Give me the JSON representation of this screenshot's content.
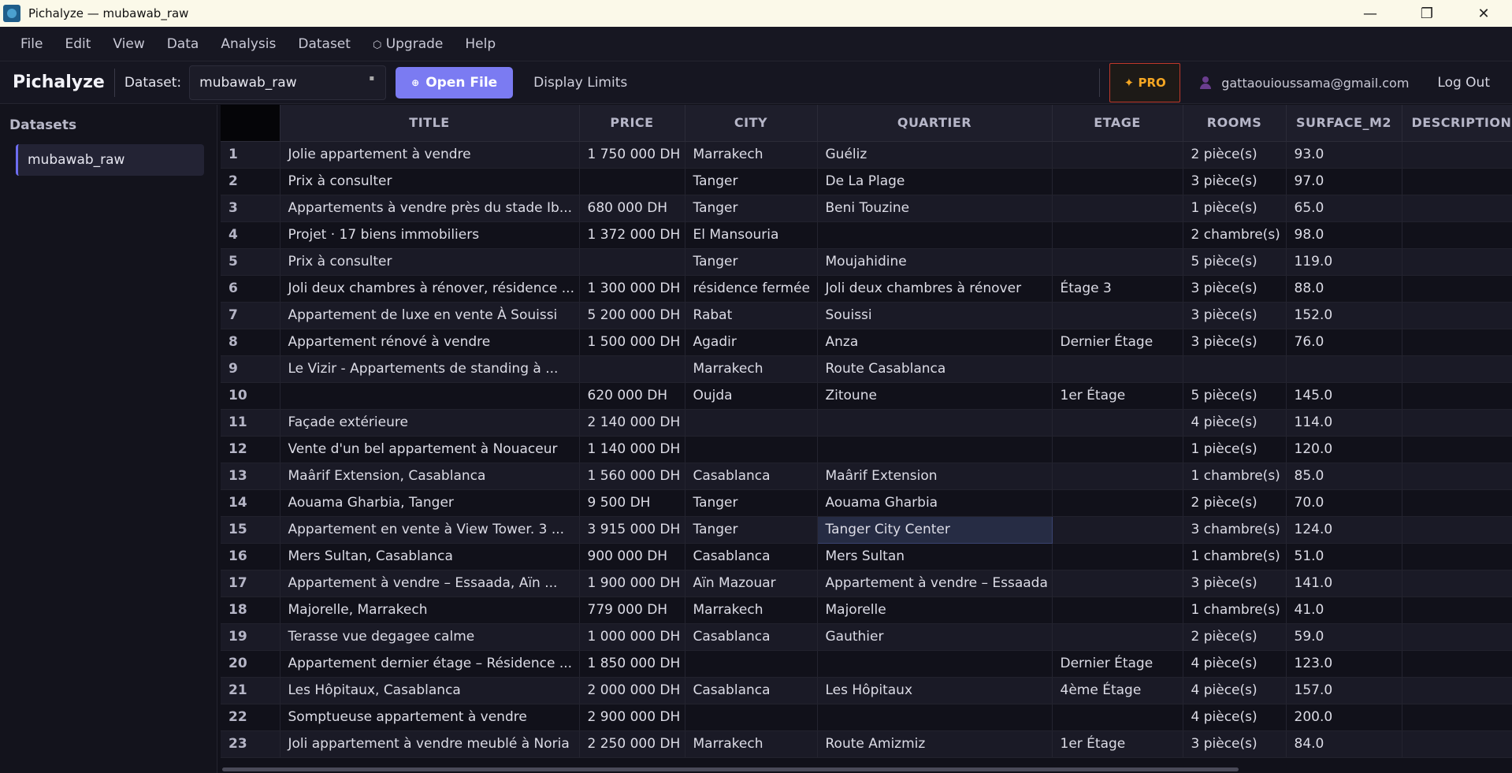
{
  "window": {
    "title": "Pichalyze — mubawab_raw",
    "controls": [
      "—",
      "❐",
      "✕"
    ]
  },
  "menu": [
    "File",
    "Edit",
    "View",
    "Data",
    "Analysis",
    "Dataset",
    "Upgrade",
    "Help"
  ],
  "toolbar": {
    "brand": "Pichalyze",
    "dataset_label": "Dataset:",
    "dataset_value": "mubawab_raw",
    "open_file": "Open File",
    "display_limits": "Display Limits",
    "pro": "✦ PRO",
    "user_email": "gattaouioussama@gmail.com",
    "logout": "Log Out"
  },
  "sidebar": {
    "title": "Datasets",
    "items": [
      "mubawab_raw"
    ]
  },
  "table": {
    "columns": [
      "TITLE",
      "PRICE",
      "CITY",
      "QUARTIER",
      "ETAGE",
      "ROOMS",
      "SURFACE_M2",
      "DESCRIPTION"
    ],
    "rows": [
      [
        "1",
        "Jolie appartement à vendre",
        "1 750 000 DH",
        "Marrakech",
        "Guéliz",
        "",
        "2 pièce(s)",
        "93.0",
        ""
      ],
      [
        "2",
        "Prix à consulter",
        "",
        "Tanger",
        "De La Plage",
        "",
        "3 pièce(s)",
        "97.0",
        ""
      ],
      [
        "3",
        "Appartements à vendre près du stade Ib...",
        "680 000 DH",
        "Tanger",
        "Beni Touzine",
        "",
        "1 pièce(s)",
        "65.0",
        ""
      ],
      [
        "4",
        "Projet · 17 biens immobiliers",
        "1 372 000 DH",
        "El Mansouria",
        "",
        "",
        "2 chambre(s)",
        "98.0",
        ""
      ],
      [
        "5",
        "Prix à consulter",
        "",
        "Tanger",
        "Moujahidine",
        "",
        "5 pièce(s)",
        "119.0",
        ""
      ],
      [
        "6",
        "Joli deux chambres à rénover, résidence ...",
        "1 300 000 DH",
        "résidence fermée",
        "Joli deux chambres à rénover",
        "Étage 3",
        "3 pièce(s)",
        "88.0",
        ""
      ],
      [
        "7",
        "Appartement de luxe en vente À Souissi",
        "5 200 000 DH",
        "Rabat",
        "Souissi",
        "",
        "3 pièce(s)",
        "152.0",
        ""
      ],
      [
        "8",
        "Appartement rénové à vendre",
        "1 500 000 DH",
        "Agadir",
        "Anza",
        "Dernier Étage",
        "3 pièce(s)",
        "76.0",
        ""
      ],
      [
        "9",
        "Le Vizir - Appartements de standing à ...",
        "",
        "Marrakech",
        "Route Casablanca",
        "",
        "",
        "",
        ""
      ],
      [
        "10",
        "",
        "620 000 DH",
        "Oujda",
        "Zitoune",
        "1er Étage",
        "5 pièce(s)",
        "145.0",
        ""
      ],
      [
        "11",
        "Façade extérieure",
        "2 140 000 DH",
        "",
        "",
        "",
        "4 pièce(s)",
        "114.0",
        ""
      ],
      [
        "12",
        "Vente d'un bel appartement à Nouaceur",
        "1 140 000 DH",
        "",
        "",
        "",
        "1 pièce(s)",
        "120.0",
        ""
      ],
      [
        "13",
        "Maârif Extension, Casablanca",
        "1 560 000 DH",
        "Casablanca",
        "Maârif Extension",
        "",
        "1 chambre(s)",
        "85.0",
        ""
      ],
      [
        "14",
        "Aouama Gharbia, Tanger",
        "9 500 DH",
        "Tanger",
        "Aouama Gharbia",
        "",
        "2 pièce(s)",
        "70.0",
        ""
      ],
      [
        "15",
        "Appartement en vente à View Tower. 3 ...",
        "3 915 000 DH",
        "Tanger",
        "Tanger City Center",
        "",
        "3 chambre(s)",
        "124.0",
        ""
      ],
      [
        "16",
        "Mers Sultan, Casablanca",
        "900 000 DH",
        "Casablanca",
        "Mers Sultan",
        "",
        "1 chambre(s)",
        "51.0",
        ""
      ],
      [
        "17",
        "Appartement à vendre – Essaada, Aïn ...",
        "1 900 000 DH",
        "Aïn Mazouar",
        "Appartement à vendre – Essaada",
        "",
        "3 pièce(s)",
        "141.0",
        ""
      ],
      [
        "18",
        "Majorelle, Marrakech",
        "779 000 DH",
        "Marrakech",
        "Majorelle",
        "",
        "1 chambre(s)",
        "41.0",
        ""
      ],
      [
        "19",
        "Terasse vue degagee calme",
        "1 000 000 DH",
        "Casablanca",
        "Gauthier",
        "",
        "2 pièce(s)",
        "59.0",
        ""
      ],
      [
        "20",
        "Appartement dernier étage – Résidence ...",
        "1 850 000 DH",
        "",
        "",
        "Dernier Étage",
        "4 pièce(s)",
        "123.0",
        ""
      ],
      [
        "21",
        "Les Hôpitaux, Casablanca",
        "2 000 000 DH",
        "Casablanca",
        "Les Hôpitaux",
        "4ème Étage",
        "4 pièce(s)",
        "157.0",
        ""
      ],
      [
        "22",
        "Somptueuse appartement à vendre",
        "2 900 000 DH",
        "",
        "",
        "",
        "4 pièce(s)",
        "200.0",
        ""
      ],
      [
        "23",
        "Joli appartement à vendre meublé à Noria",
        "2 250 000 DH",
        "Marrakech",
        "Route Amizmiz",
        "1er Étage",
        "3 pièce(s)",
        "84.0",
        ""
      ]
    ],
    "selected_cell": {
      "row": 15,
      "column": "QUARTIER"
    }
  }
}
